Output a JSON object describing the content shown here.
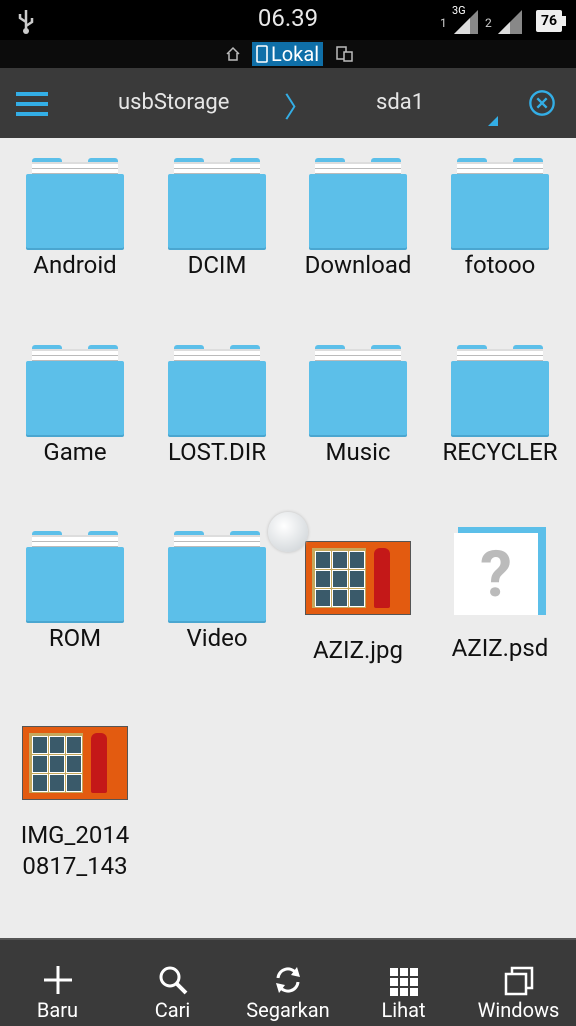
{
  "status": {
    "time": "06.39",
    "sim1": "1",
    "sim1_net": "3G",
    "sim2": "2",
    "battery": "76"
  },
  "location": {
    "lokal_label": "Lokal"
  },
  "toolbar": {
    "crumb1": "usbStorage",
    "crumb_sep": "〉",
    "crumb2": "sda1"
  },
  "files": [
    {
      "name": "Android",
      "type": "folder"
    },
    {
      "name": "DCIM",
      "type": "folder"
    },
    {
      "name": "Download",
      "type": "folder"
    },
    {
      "name": "fotooo",
      "type": "folder"
    },
    {
      "name": "Game",
      "type": "folder"
    },
    {
      "name": "LOST.DIR",
      "type": "folder"
    },
    {
      "name": "Music",
      "type": "folder"
    },
    {
      "name": "RECYCLER",
      "type": "folder"
    },
    {
      "name": "ROM",
      "type": "folder"
    },
    {
      "name": "Video",
      "type": "folder"
    },
    {
      "name": "AZIZ.jpg",
      "type": "image"
    },
    {
      "name": "AZIZ.psd",
      "type": "psd"
    },
    {
      "name": "IMG_20140817_143",
      "type": "image"
    }
  ],
  "bottom": {
    "new": "Baru",
    "search": "Cari",
    "refresh": "Segarkan",
    "view": "Lihat",
    "windows": "Windows"
  },
  "colors": {
    "accent": "#33aee6",
    "folder": "#5cbfe9",
    "bar": "#3a3a3a"
  }
}
